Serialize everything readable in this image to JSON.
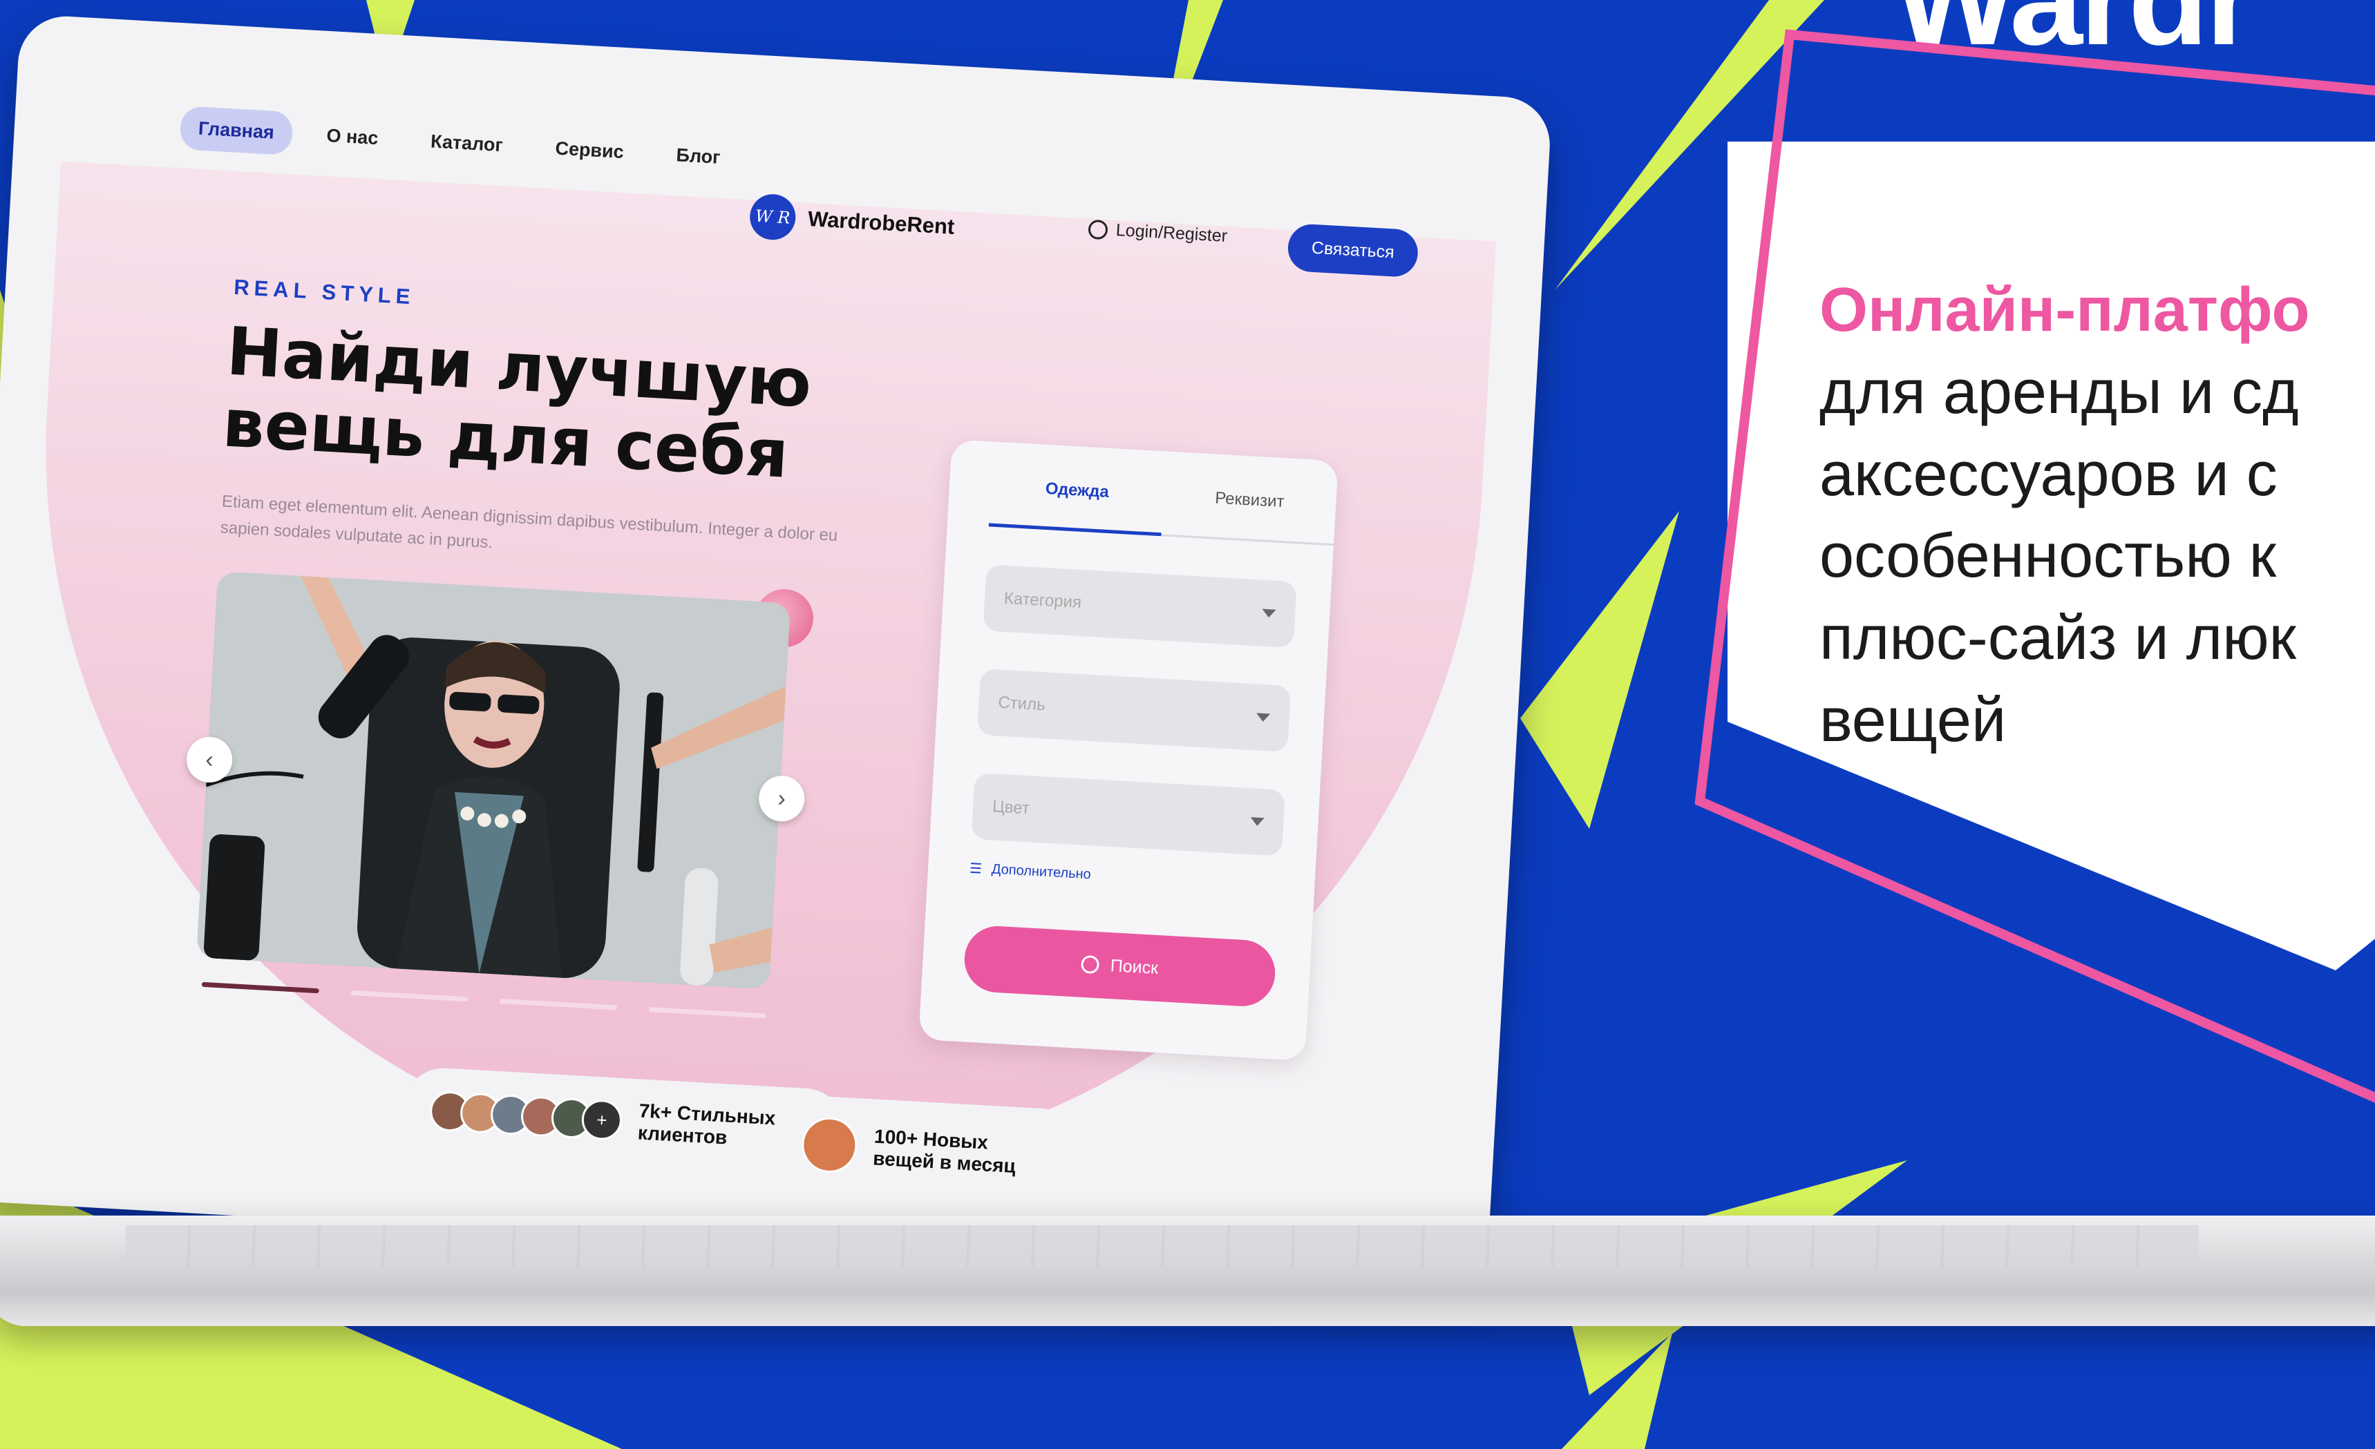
{
  "colors": {
    "background_blue": "#0b3cc0",
    "lime": "#d8f25a",
    "accent_pink": "#ee57a1",
    "brand_blue": "#1d3fc4"
  },
  "brand_partial": "Wardr",
  "site": {
    "nav": [
      "Главная",
      "О нас",
      "Каталог",
      "Сервис",
      "Блог"
    ],
    "logo_mark": "W R",
    "logo_text": "WardrobeRent",
    "login": "Login/Register",
    "contact_button": "Связаться",
    "tagline": "REAL STYLE",
    "hero_line1": "Найди лучшую",
    "hero_line2": "вещь для себя",
    "lorem": "Etiam eget elementum elit. Aenean dignissim dapibus vestibulum. Integer a dolor eu sapien sodales vulputate ac in purus.",
    "carousel": {
      "prev": "‹",
      "next": "›",
      "slides": 4,
      "active": 1
    },
    "search_form": {
      "tabs": [
        "Одежда",
        "Реквизит"
      ],
      "fields": [
        "Категория",
        "Стиль",
        "Цвет"
      ],
      "more_link": "Дополнительно",
      "search_button": "Поиск"
    },
    "stats": [
      {
        "text": "7k+ Стильных клиентов",
        "plus": "+"
      },
      {
        "text": "100+ Новых вещей в месяц"
      }
    ]
  },
  "card": {
    "title": "Онлайн-платфо",
    "lines": [
      "для аренды и сд",
      "аксессуаров и с",
      "особенностью к",
      "плюс-сайз и люк",
      "вещей"
    ]
  }
}
